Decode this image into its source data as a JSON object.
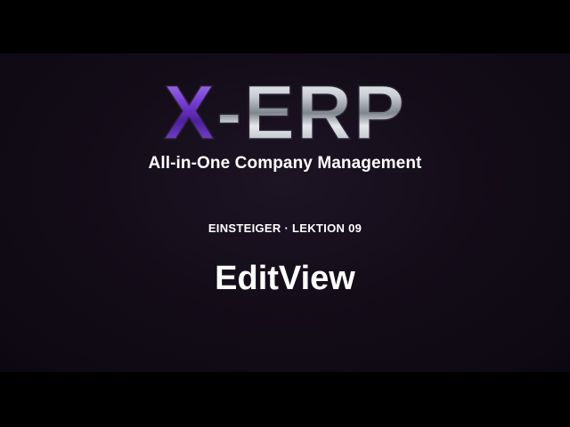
{
  "logo": {
    "text_purple": "X",
    "text_silver": "-ERP",
    "purple_color": "#7b3fd6",
    "silver_color": "#d8dde2"
  },
  "tagline": "All-in-One Company Management",
  "lesson_label": "EINSTEIGER · LEKTION 09",
  "topic_title": "EditView"
}
